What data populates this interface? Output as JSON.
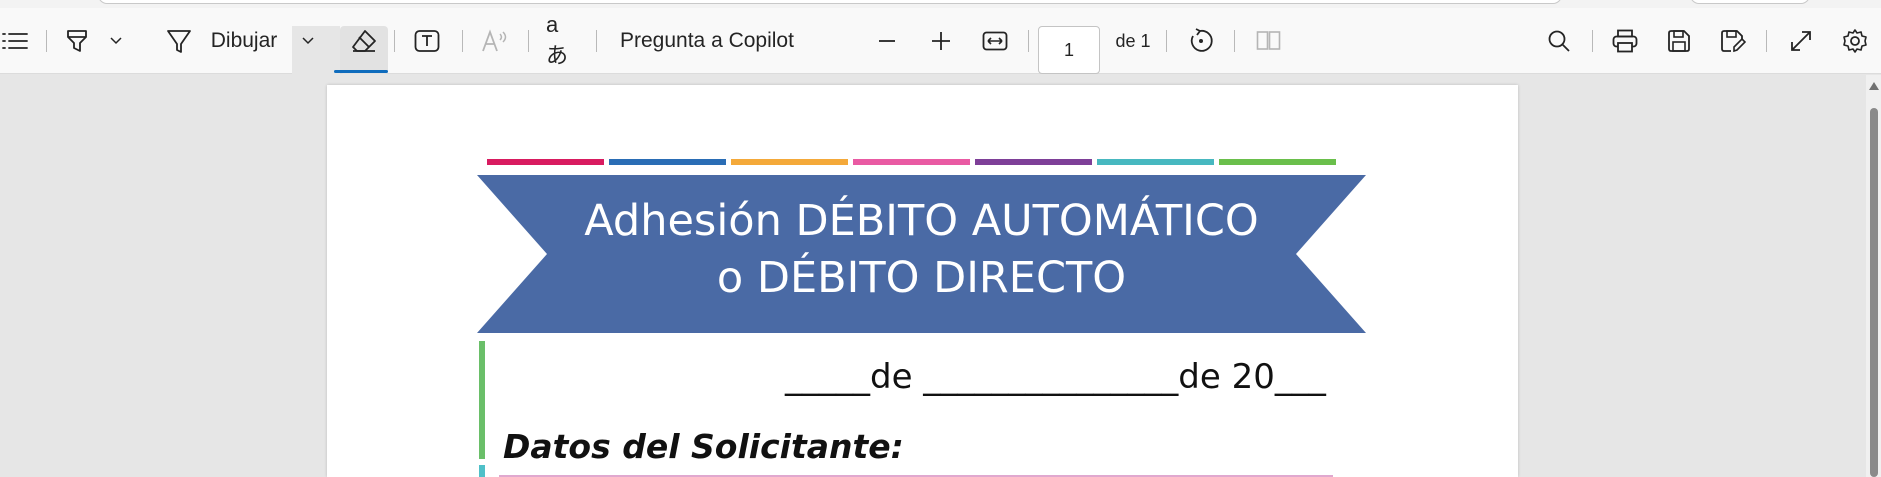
{
  "toolbar": {
    "draw_label": "Dibujar",
    "copilot_label": "Pregunta a Copilot",
    "page_number": "1",
    "page_total": "de 1",
    "icons": {
      "contents": "list-icon",
      "highlight": "highlighter-icon",
      "highlight_dropdown": "chevron-down-icon",
      "draw": "pen-icon",
      "draw_dropdown": "chevron-down-icon",
      "erase": "eraser-icon",
      "text": "text-box-icon",
      "read_aloud": "read-aloud-icon",
      "translate": "translate-icon",
      "zoom_out": "minus-icon",
      "zoom_in": "plus-icon",
      "fit": "fit-width-icon",
      "rotate": "rotate-icon",
      "page_view": "page-view-icon",
      "search": "search-icon",
      "print": "print-icon",
      "save": "save-icon",
      "save_as": "save-as-icon",
      "fullscreen": "fullscreen-icon",
      "settings": "gear-icon"
    }
  },
  "document": {
    "banner_line1": "Adhesión DÉBITO AUTOMÁTICO",
    "banner_line2": "o DÉBITO DIRECTO",
    "date_line": "_____de _______________de 20___",
    "section_title": "Datos del Solicitante:",
    "banner_color": "#4a6aa5",
    "stripe_colors": [
      "#d81b60",
      "#2a6db5",
      "#f4a93a",
      "#e95aa3",
      "#7e3f98",
      "#47b8c0",
      "#6abf4b"
    ]
  },
  "colors": {
    "accent": "#0f6cbd",
    "toolbar_bg": "#f9f9f9",
    "viewer_bg": "#e6e6e6"
  }
}
